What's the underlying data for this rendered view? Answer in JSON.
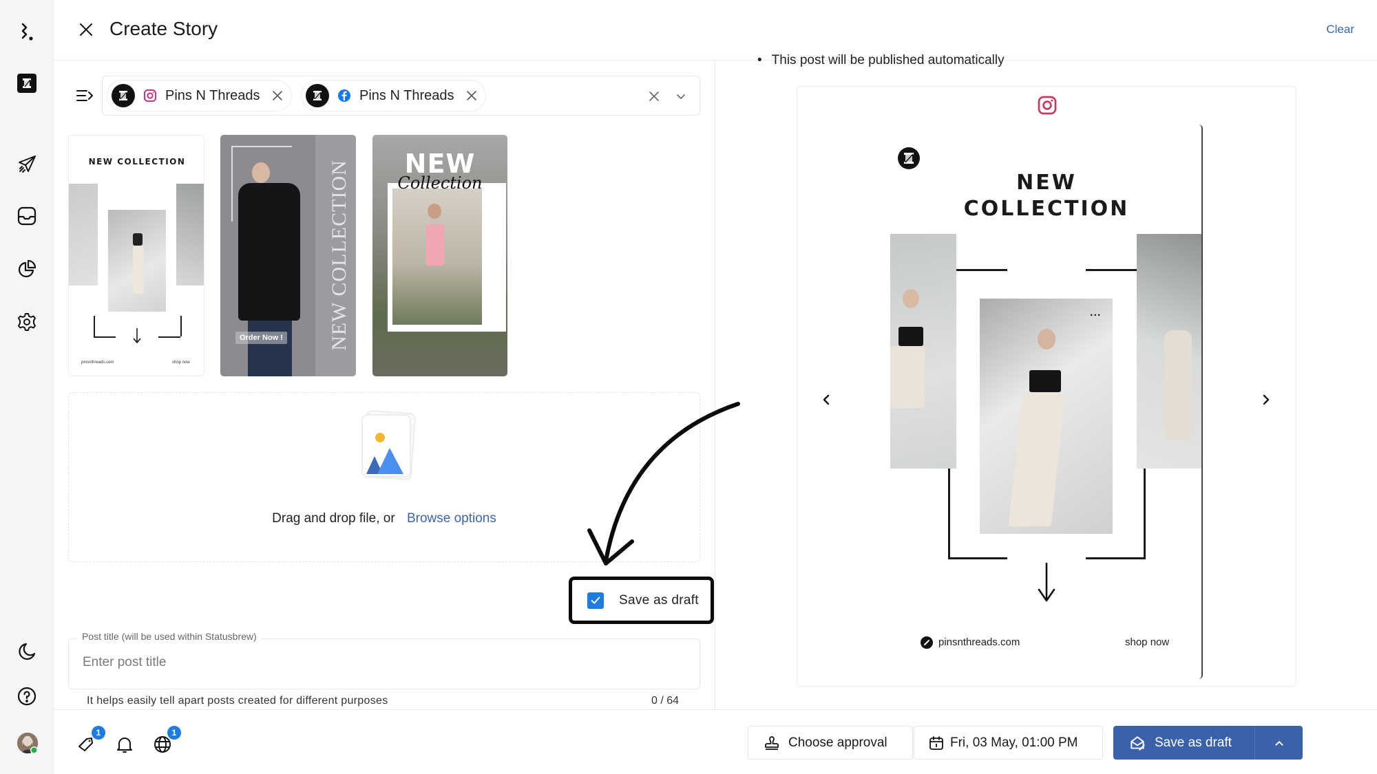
{
  "header": {
    "title": "Create Story",
    "clear_label": "Clear"
  },
  "sidebar": {
    "items": [
      {
        "name": "brand-logo",
        "icon": "statusbrew-logo-icon"
      },
      {
        "name": "workspace",
        "icon": "pins-n-threads-logo-icon"
      },
      {
        "name": "publish",
        "icon": "paper-plane-icon"
      },
      {
        "name": "inbox",
        "icon": "inbox-tray-icon"
      },
      {
        "name": "reports",
        "icon": "pie-chart-icon"
      },
      {
        "name": "settings",
        "icon": "gear-icon"
      },
      {
        "name": "dark-mode",
        "icon": "moon-icon"
      },
      {
        "name": "help",
        "icon": "question-circle-icon"
      },
      {
        "name": "profile",
        "icon": "user-avatar-icon",
        "status": "online"
      }
    ]
  },
  "accounts": {
    "selected": [
      {
        "name": "Pins N Threads",
        "network": "instagram",
        "network_color": "#c13584"
      },
      {
        "name": "Pins N Threads",
        "network": "facebook",
        "network_color": "#1877f2"
      }
    ]
  },
  "media": {
    "thumbnails": [
      {
        "title": "NEW COLLECTION",
        "footer_left": "pinsnthreads.com",
        "footer_right": "shop now"
      },
      {
        "title": "NEW COLLECTION",
        "cta": "Order Now !"
      },
      {
        "title": "NEW",
        "subtitle": "Collection"
      }
    ],
    "dropzone": {
      "text": "Drag and drop file, or",
      "browse_label": "Browse options"
    }
  },
  "draft": {
    "label": "Save as draft",
    "checked": true
  },
  "post_title": {
    "legend": "Post title (will be used within Statusbrew)",
    "placeholder": "Enter post title",
    "value": "",
    "helper": "It helps easily tell apart posts created for different purposes",
    "count": "0 / 64"
  },
  "preview": {
    "note": "This post will be published automatically",
    "network_icon": "instagram-icon",
    "story": {
      "title_line1": "NEW",
      "title_line2": "COLLECTION",
      "website": "pinsnthreads.com",
      "cta": "shop now",
      "more": "..."
    }
  },
  "footer": {
    "tag_badge": "1",
    "globe_badge": "1",
    "approval_label": "Choose approval",
    "schedule_label": "Fri, 03 May, 01:00 PM",
    "save_label": "Save as draft"
  },
  "colors": {
    "primary": "#3a62ab",
    "link": "#3d64ad",
    "checkbox": "#1e7be0",
    "instagram": "#c13584",
    "facebook": "#1877f2",
    "online": "#22b14c"
  }
}
